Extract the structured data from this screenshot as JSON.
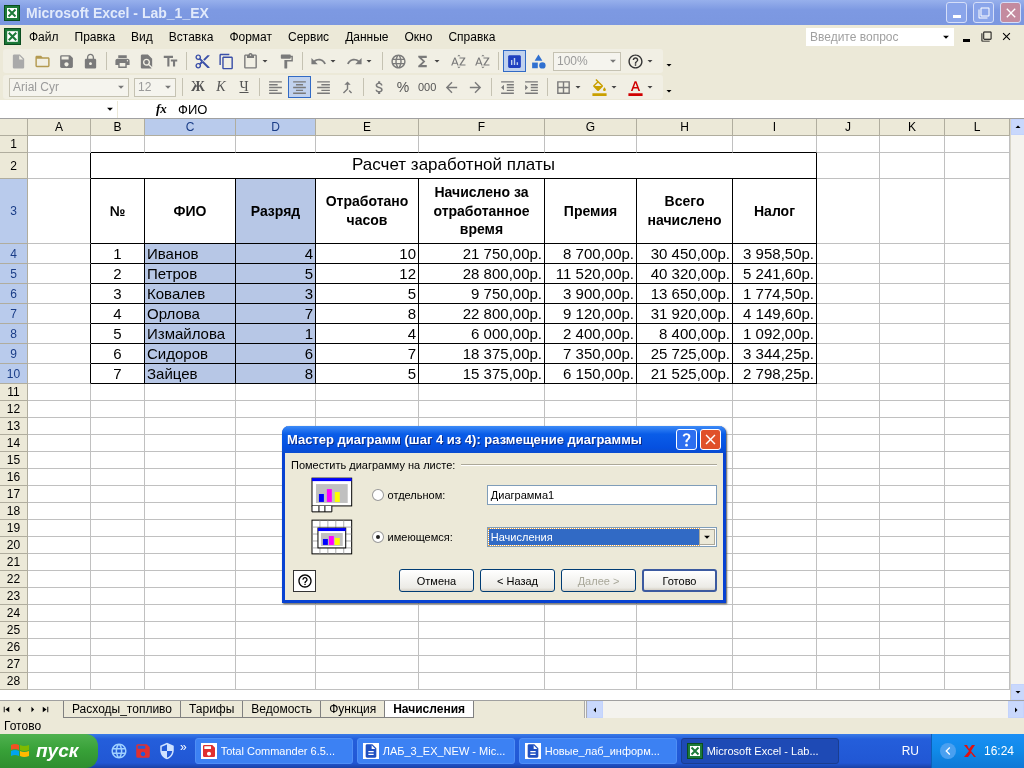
{
  "window": {
    "title": "Microsoft Excel - Lab_1_EX"
  },
  "menu": {
    "items": [
      "Файл",
      "Правка",
      "Вид",
      "Вставка",
      "Формат",
      "Сервис",
      "Данные",
      "Окно",
      "Справка"
    ],
    "help_placeholder": "Введите вопрос"
  },
  "toolbars": [
    {
      "items": [
        {
          "kind": "button",
          "pressed": false
        },
        {
          "kind": "button",
          "pressed": false
        },
        {
          "kind": "button",
          "pressed": false
        },
        {
          "kind": "button",
          "pressed": false
        },
        {
          "kind": "separator"
        },
        {
          "kind": "button",
          "pressed": false
        },
        {
          "kind": "button",
          "pressed": false
        },
        {
          "kind": "button",
          "pressed": false
        },
        {
          "kind": "separator"
        },
        {
          "kind": "button",
          "pressed": false
        },
        {
          "kind": "button",
          "pressed": false
        },
        {
          "kind": "button",
          "pressed": false
        },
        {
          "kind": "button",
          "pressed": false
        },
        {
          "kind": "separator"
        },
        {
          "kind": "button",
          "pressed": false
        },
        {
          "kind": "button",
          "pressed": false
        },
        {
          "kind": "separator"
        },
        {
          "kind": "button",
          "pressed": false
        },
        {
          "kind": "button",
          "pressed": false
        },
        {
          "kind": "button",
          "pressed": false
        },
        {
          "kind": "button",
          "pressed": false
        },
        {
          "kind": "separator"
        },
        {
          "kind": "button",
          "pressed": true
        },
        {
          "kind": "button",
          "pressed": false
        },
        {
          "kind": "combo",
          "value": "100%",
          "disabled": true
        },
        {
          "kind": "button",
          "pressed": false
        }
      ]
    },
    {
      "items": [
        {
          "kind": "combo",
          "value": "Arial Cyr",
          "disabled": true
        },
        {
          "kind": "combo",
          "value": "12",
          "disabled": true
        },
        {
          "kind": "separator"
        },
        {
          "kind": "text",
          "label": "Ж",
          "pressed": false
        },
        {
          "kind": "text",
          "label": "К",
          "pressed": false
        },
        {
          "kind": "text",
          "label": "Ч",
          "pressed": false
        },
        {
          "kind": "separator"
        },
        {
          "kind": "button",
          "pressed": false
        },
        {
          "kind": "button",
          "pressed": true
        },
        {
          "kind": "button",
          "pressed": false
        },
        {
          "kind": "button",
          "pressed": false
        },
        {
          "kind": "separator"
        },
        {
          "kind": "button",
          "pressed": false
        },
        {
          "kind": "text",
          "label": "%",
          "pressed": false
        },
        {
          "kind": "text",
          "label": "000",
          "pressed": false
        },
        {
          "kind": "button",
          "pressed": false
        },
        {
          "kind": "button",
          "pressed": false
        },
        {
          "kind": "separator"
        },
        {
          "kind": "button",
          "pressed": false
        },
        {
          "kind": "button",
          "pressed": false
        },
        {
          "kind": "separator"
        },
        {
          "kind": "button",
          "pressed": false
        },
        {
          "kind": "button",
          "pressed": false
        },
        {
          "kind": "button",
          "pressed": false
        }
      ]
    }
  ],
  "formula_bar": {
    "fx": "fx",
    "value": "ФИО"
  },
  "sheet": {
    "columns": [
      {
        "label": "A",
        "selected": false
      },
      {
        "label": "B",
        "selected": false
      },
      {
        "label": "C",
        "selected": true
      },
      {
        "label": "D",
        "selected": true
      },
      {
        "label": "E",
        "selected": false
      },
      {
        "label": "F",
        "selected": false
      },
      {
        "label": "G",
        "selected": false
      },
      {
        "label": "H",
        "selected": false
      },
      {
        "label": "I",
        "selected": false
      },
      {
        "label": "J",
        "selected": false
      },
      {
        "label": "K",
        "selected": false
      },
      {
        "label": "L",
        "selected": false
      }
    ],
    "rows": [
      {
        "label": "1",
        "kind": "blank",
        "selected": false
      },
      {
        "label": "2",
        "kind": "title",
        "selected": false,
        "title": "Расчет заработной платы"
      },
      {
        "label": "3",
        "kind": "header",
        "selected": true,
        "cells": [
          "№",
          "ФИО",
          "Разряд",
          "Отработано часов",
          "Начислено за отработанное время",
          "Премия",
          "Всего начислено",
          "Налог"
        ]
      },
      {
        "label": "4",
        "kind": "data",
        "selected": true,
        "cells": [
          "1",
          "Иванов",
          "4",
          "10",
          "21 750,00р.",
          "8 700,00р.",
          "30 450,00р.",
          "3 958,50р."
        ]
      },
      {
        "label": "5",
        "kind": "data",
        "selected": true,
        "cells": [
          "2",
          "Петров",
          "5",
          "12",
          "28 800,00р.",
          "11 520,00р.",
          "40 320,00р.",
          "5 241,60р."
        ]
      },
      {
        "label": "6",
        "kind": "data",
        "selected": true,
        "cells": [
          "3",
          "Ковалев",
          "3",
          "5",
          "9 750,00р.",
          "3 900,00р.",
          "13 650,00р.",
          "1 774,50р."
        ]
      },
      {
        "label": "7",
        "kind": "data",
        "selected": true,
        "cells": [
          "4",
          "Орлова",
          "7",
          "8",
          "22 800,00р.",
          "9 120,00р.",
          "31 920,00р.",
          "4 149,60р."
        ]
      },
      {
        "label": "8",
        "kind": "data",
        "selected": true,
        "cells": [
          "5",
          "Измайлова",
          "1",
          "4",
          "6 000,00р.",
          "2 400,00р.",
          "8 400,00р.",
          "1 092,00р."
        ]
      },
      {
        "label": "9",
        "kind": "data",
        "selected": true,
        "cells": [
          "6",
          "Сидоров",
          "6",
          "7",
          "18 375,00р.",
          "7 350,00р.",
          "25 725,00р.",
          "3 344,25р."
        ]
      },
      {
        "label": "10",
        "kind": "data",
        "selected": true,
        "cells": [
          "7",
          "Зайцев",
          "8",
          "5",
          "15 375,00р.",
          "6 150,00р.",
          "21 525,00р.",
          "2 798,25р."
        ]
      },
      {
        "label": "11",
        "kind": "blank",
        "selected": false
      },
      {
        "label": "12",
        "kind": "blank",
        "selected": false
      },
      {
        "label": "13",
        "kind": "blank",
        "selected": false
      },
      {
        "label": "14",
        "kind": "blank",
        "selected": false
      },
      {
        "label": "15",
        "kind": "blank",
        "selected": false
      },
      {
        "label": "16",
        "kind": "blank",
        "selected": false
      },
      {
        "label": "17",
        "kind": "blank",
        "selected": false
      },
      {
        "label": "18",
        "kind": "blank",
        "selected": false
      },
      {
        "label": "19",
        "kind": "blank",
        "selected": false
      },
      {
        "label": "20",
        "kind": "blank",
        "selected": false
      },
      {
        "label": "21",
        "kind": "blank",
        "selected": false
      },
      {
        "label": "22",
        "kind": "blank",
        "selected": false
      },
      {
        "label": "23",
        "kind": "blank",
        "selected": false
      },
      {
        "label": "24",
        "kind": "blank",
        "selected": false
      },
      {
        "label": "25",
        "kind": "blank",
        "selected": false
      },
      {
        "label": "26",
        "kind": "blank",
        "selected": false
      },
      {
        "label": "27",
        "kind": "blank",
        "selected": false
      },
      {
        "label": "28",
        "kind": "blank",
        "selected": false
      }
    ]
  },
  "dialog": {
    "title": "Мастер диаграмм (шаг 4 из 4): размещение диаграммы",
    "group_label": "Поместить диаграмму на листе:",
    "options": [
      {
        "kind": "text",
        "label": "отдельном:",
        "selected": false,
        "value": "Диаграмма1"
      },
      {
        "kind": "select",
        "label": "имеющемся:",
        "selected": true,
        "value": "Начисления"
      }
    ],
    "buttons": [
      {
        "label": "Отмена",
        "disabled": false,
        "default": false
      },
      {
        "label": "< Назад",
        "disabled": false,
        "default": false
      },
      {
        "label": "Далее >",
        "disabled": true,
        "default": false
      },
      {
        "label": "Готово",
        "disabled": false,
        "default": true
      }
    ]
  },
  "sheet_tabs": [
    {
      "label": "Расходы_топливо",
      "selected": false
    },
    {
      "label": "Тарифы",
      "selected": false
    },
    {
      "label": "Ведомость",
      "selected": false
    },
    {
      "label": "Функция",
      "selected": false
    },
    {
      "label": "Начисления",
      "selected": true
    }
  ],
  "status_bar": {
    "text": "Готово"
  },
  "taskbar": {
    "start": "пуск",
    "more": "»",
    "tasks": [
      {
        "kind": "commander",
        "label": "Total Commander 6.5...",
        "selected": false
      },
      {
        "kind": "word",
        "label": "ЛАБ_3_EX_NEW - Mic...",
        "selected": false
      },
      {
        "kind": "word",
        "label": "Новые_лаб_информ...",
        "selected": false
      },
      {
        "kind": "excel",
        "label": "Microsoft Excel - Lab...",
        "selected": true
      }
    ],
    "language": "RU",
    "clock": "16:24"
  }
}
